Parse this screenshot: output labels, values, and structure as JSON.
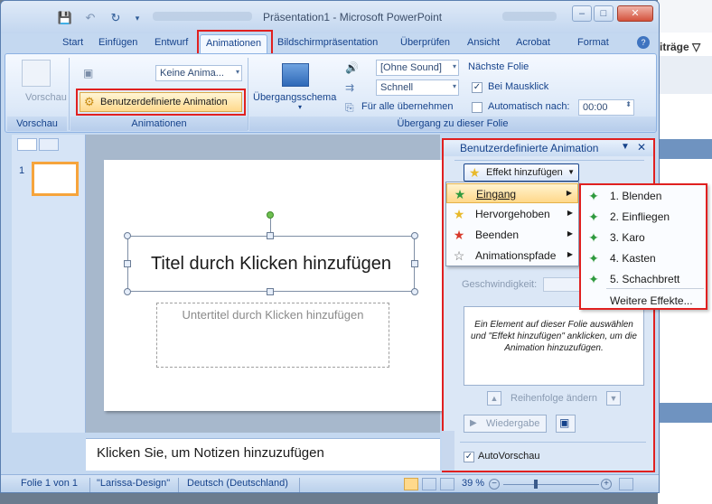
{
  "background": {
    "right_header": "iträge ▽"
  },
  "window": {
    "title": "Präsentation1 - Microsoft PowerPoint",
    "qat": {
      "save_icon": "💾",
      "undo_icon": "↶",
      "redo_icon": "↻"
    },
    "controls": {
      "minimize": "–",
      "maximize": "□",
      "close": "✕"
    }
  },
  "tabs": [
    {
      "label": "Start"
    },
    {
      "label": "Einfügen"
    },
    {
      "label": "Entwurf"
    },
    {
      "label": "Animationen"
    },
    {
      "label": "Bildschirmpräsentation"
    },
    {
      "label": "Überprüfen"
    },
    {
      "label": "Ansicht"
    },
    {
      "label": "Acrobat"
    },
    {
      "label": "Format"
    }
  ],
  "ribbon": {
    "vorschau": {
      "button_label": "Vorschau",
      "group_label": "Vorschau"
    },
    "animationen": {
      "animate_select": "Keine Anima...",
      "custom_animation_label": "Benutzerdefinierte Animation",
      "group_label": "Animationen"
    },
    "uebergang": {
      "scheme_label": "Übergangsschema",
      "sound_select": "[Ohne Sound]",
      "speed_select": "Schnell",
      "apply_all_label": "Für alle übernehmen",
      "next_slide_label": "Nächste Folie",
      "on_click_label": "Bei Mausklick",
      "on_click_checked": "✓",
      "auto_after_label": "Automatisch nach:",
      "auto_after_value": "00:00",
      "group_label": "Übergang zu dieser Folie"
    }
  },
  "slides_pane": {
    "slide_number": "1"
  },
  "slide": {
    "title_placeholder": "Titel durch Klicken hinzufügen",
    "subtitle_placeholder": "Untertitel durch Klicken hinzufügen"
  },
  "notes": {
    "placeholder": "Klicken Sie, um Notizen hinzuzufügen"
  },
  "statusbar": {
    "slide_info": "Folie 1 von 1",
    "theme": "\"Larissa-Design\"",
    "language": "Deutsch (Deutschland)",
    "zoom": "39 %"
  },
  "task_pane": {
    "title": "Benutzerdefinierte Animation",
    "add_effect_label": "Effekt hinzufügen",
    "speed_label": "Geschwindigkeit:",
    "description": "Ein Element auf dieser Folie auswählen und \"Effekt hinzufügen\" anklicken, um die Animation hinzuzufügen.",
    "reorder_label": "Reihenfolge ändern",
    "play_label": "Wiedergabe",
    "autopreview_label": "AutoVorschau",
    "autopreview_checked": "✓"
  },
  "effect_menu": {
    "items": [
      {
        "label": "Eingang",
        "icon": "green-star-icon"
      },
      {
        "label": "Hervorgehoben",
        "icon": "yellow-star-icon"
      },
      {
        "label": "Beenden",
        "icon": "red-star-icon"
      },
      {
        "label": "Animationspfade",
        "icon": "outline-star-icon"
      }
    ]
  },
  "entrance_submenu": {
    "items": [
      {
        "label": "1. Blenden"
      },
      {
        "label": "2. Einfliegen"
      },
      {
        "label": "3. Karo"
      },
      {
        "label": "4. Kasten"
      },
      {
        "label": "5. Schachbrett"
      }
    ],
    "more_label": "Weitere Effekte..."
  },
  "colors": {
    "accent": "#15428b",
    "highlight": "#e02020",
    "menu_hover": "#ffd88a"
  }
}
